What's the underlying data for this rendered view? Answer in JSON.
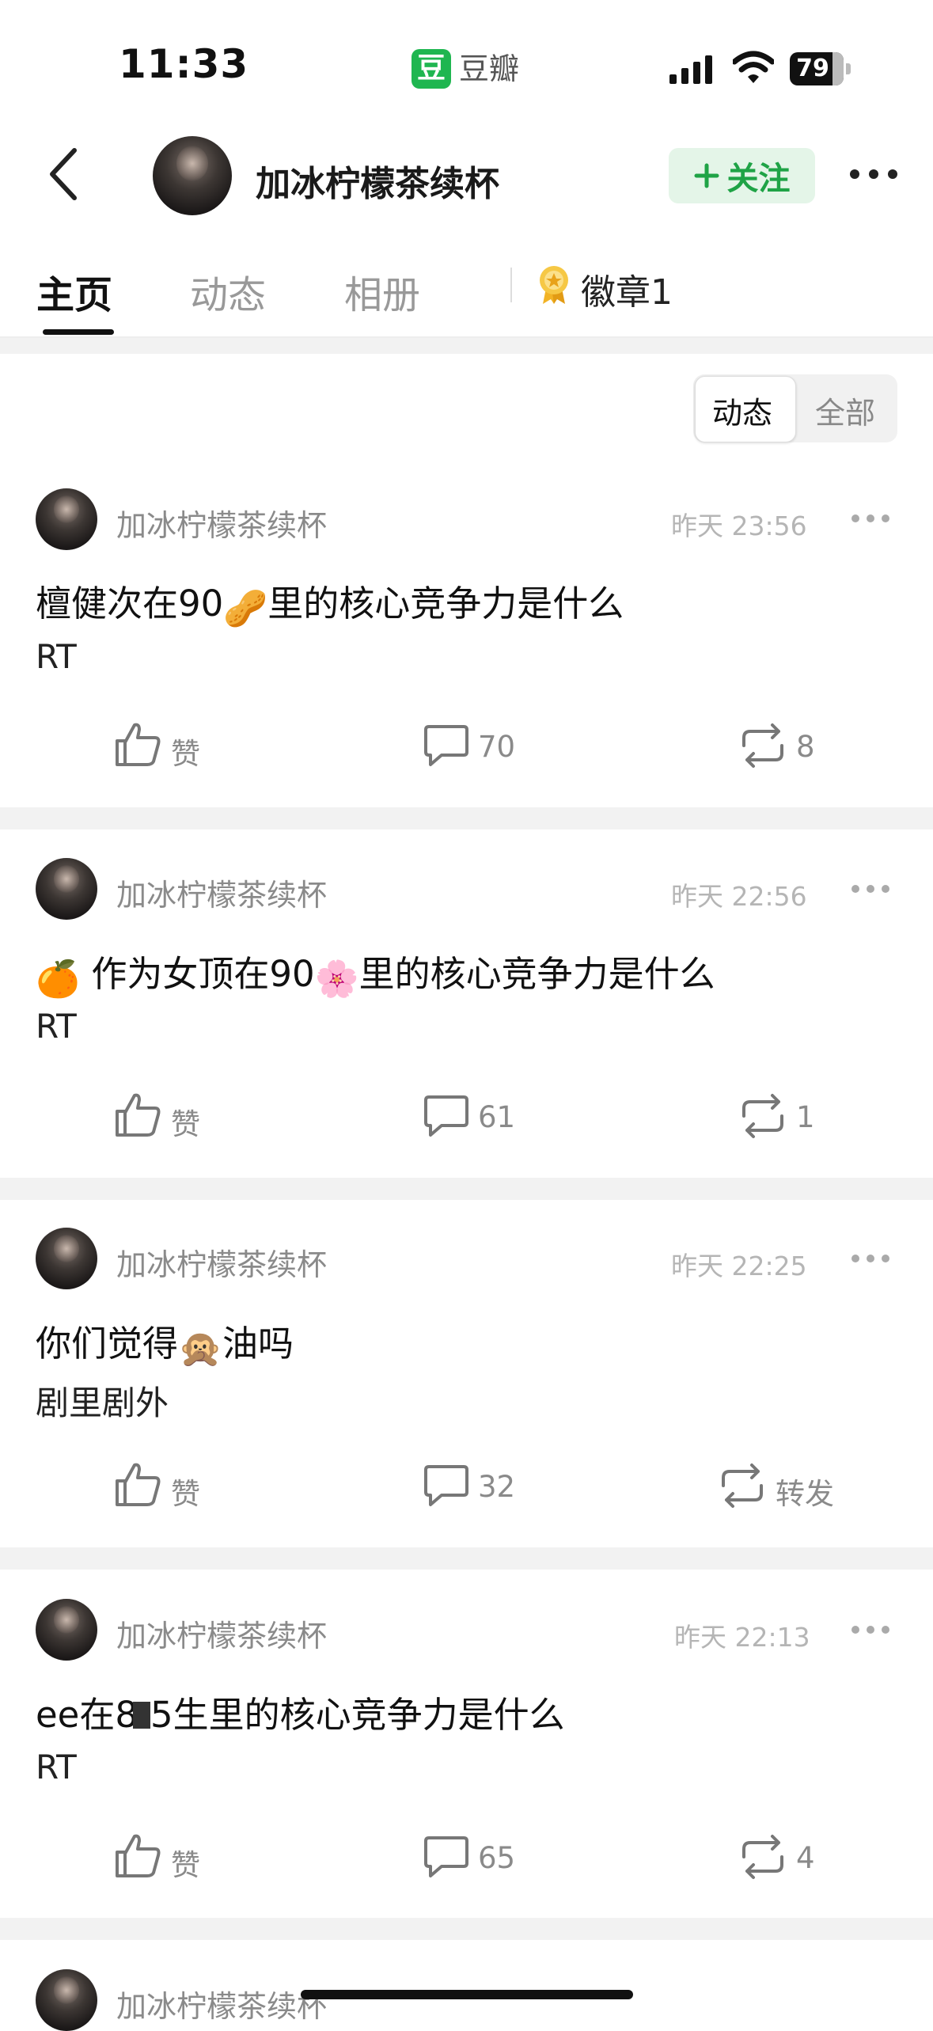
{
  "status_bar": {
    "time": "11:33",
    "app_icon_text": "豆",
    "app_name": "豆瓣",
    "battery": "79"
  },
  "header": {
    "name": "加冰柠檬茶续杯",
    "follow_label": "关注"
  },
  "tabs": {
    "home": "主页",
    "activity": "动态",
    "album": "相册",
    "badges": "徽章1"
  },
  "filter": {
    "active": "动态",
    "all": "全部"
  },
  "posts": [
    {
      "author": "加冰柠檬茶续杯",
      "time": "昨天 23:56",
      "title_a": "檀健次在90",
      "emoji": "🥜",
      "title_b": "里的核心竞争力是什么",
      "body": "RT",
      "like": "赞",
      "comments": "70",
      "reposts": "8"
    },
    {
      "author": "加冰柠檬茶续杯",
      "time": "昨天 22:56",
      "title_pre": "🍊",
      "title_a": " 作为女顶在90",
      "emoji": "🌸",
      "title_b": "里的核心竞争力是什么",
      "body": "RT",
      "like": "赞",
      "comments": "61",
      "reposts": "1"
    },
    {
      "author": "加冰柠檬茶续杯",
      "time": "昨天 22:25",
      "title_a": "你们觉得",
      "emoji": "🙊",
      "title_b": "油吗",
      "body": "剧里剧外",
      "like": "赞",
      "comments": "32",
      "reposts": "转发"
    },
    {
      "author": "加冰柠檬茶续杯",
      "time": "昨天 22:13",
      "title_a": "ee在8",
      "title_b": "5生里的核心竞争力是什么",
      "body": "RT",
      "like": "赞",
      "comments": "65",
      "reposts": "4"
    },
    {
      "author": "加冰柠檬茶续杯"
    }
  ]
}
